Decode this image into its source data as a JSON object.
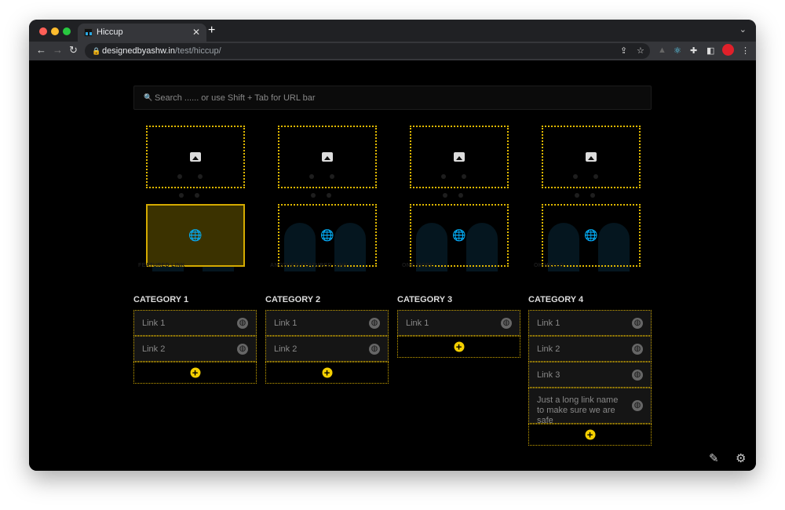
{
  "browser": {
    "tab_title": "Hiccup",
    "url_host": "designedbyashw.in",
    "url_path": "/test/hiccup/"
  },
  "search": {
    "placeholder": "Search   ...... or use Shift + Tab for URL bar"
  },
  "featured": [
    {
      "label": "FEATURED LINK",
      "active": true
    },
    {
      "label": "ANOTHER FEATURED LINK",
      "active": false
    },
    {
      "label": "ONE MORE",
      "active": false
    },
    {
      "label": "OH HELLO",
      "active": false
    }
  ],
  "categories": [
    {
      "title": "CATEGORY 1",
      "links": [
        "Link 1",
        "Link 2"
      ]
    },
    {
      "title": "CATEGORY 2",
      "links": [
        "Link 1",
        "Link 2"
      ]
    },
    {
      "title": "CATEGORY 3",
      "links": [
        "Link 1"
      ]
    },
    {
      "title": "CATEGORY 4",
      "links": [
        "Link 1",
        "Link 2",
        "Link 3",
        "Just a long link name to make sure we are safe"
      ]
    }
  ],
  "colors": {
    "accent": "#f5d000",
    "border": "#c9a300",
    "background": "#000000"
  }
}
